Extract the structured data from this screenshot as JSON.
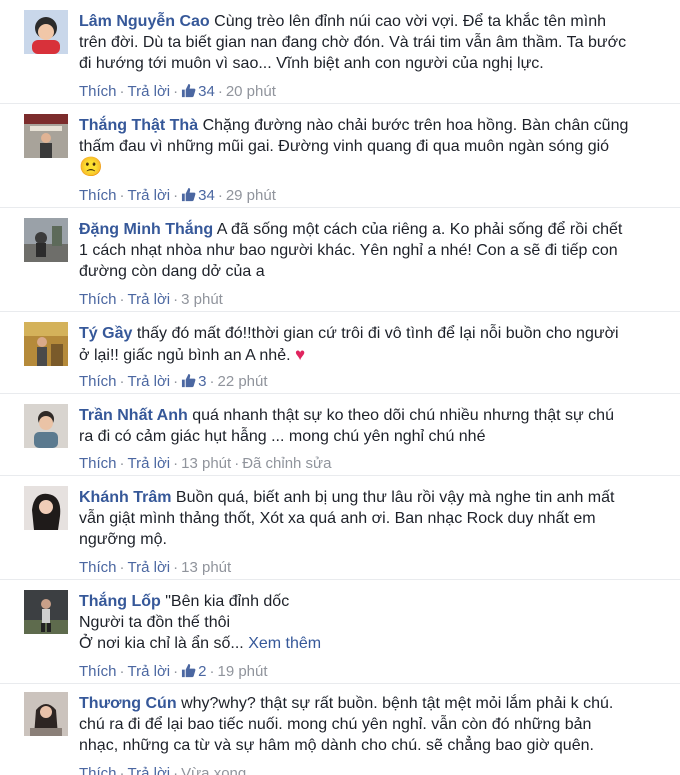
{
  "ui": {
    "like_label": "Thích",
    "reply_label": "Trả lời",
    "dot": "·"
  },
  "comments": [
    {
      "author": "Lâm Nguyễn Cao",
      "lines": [
        "Cùng trèo lên đỉnh núi cao vời vợi. Để ta khắc tên mình",
        "trên đời. Dù ta biết gian nan đang chờ đón. Và trái tim vẫn âm thầm. Ta bước",
        "đi hướng tới muôn vì sao... Vĩnh biệt anh con người của nghị lực."
      ],
      "likes": "34",
      "time": "20 phút"
    },
    {
      "author": "Thắng Thật Thà",
      "lines": [
        "Chặng đường nào chải bước trên hoa hồng. Bàn chân cũng",
        "thấm đau vì những mũi gai. Đường vinh quang đi qua muôn ngàn sóng gió"
      ],
      "emoji": "🙁",
      "likes": "34",
      "time": "29 phút"
    },
    {
      "author": "Đặng Minh Thắng",
      "lines": [
        "A đã sống một cách của riêng a. Ko phải sống để rồi chết",
        "1 cách nhạt nhòa như bao người khác. Yên nghỉ a nhé! Con a sẽ đi tiếp con",
        "đường còn dang dở của a"
      ],
      "time": "3 phút"
    },
    {
      "author": "Tý Gầy",
      "lines": [
        "thấy đó mất đó!!thời gian cứ trôi đi vô tình để lại nỗi buồn cho người",
        "ở lại!! giấc ngủ bình an A nhẻ."
      ],
      "heart": "♥",
      "likes": "3",
      "time": "22 phút"
    },
    {
      "author": "Trần Nhất Anh",
      "lines": [
        "quá nhanh thật sự ko theo dõi chú nhiều nhưng thật sự chú",
        "ra đi có cảm giác hụt hẫng ... mong chú yên nghỉ chú nhé"
      ],
      "time": "13 phút",
      "edited": "Đã chỉnh sửa"
    },
    {
      "author": "Khánh Trâm",
      "lines": [
        "Buồn quá, biết anh bị ung thư lâu rồi vậy mà nghe tin anh mất",
        "vẫn giật mình thảng thốt, Xót xa quá anh ơi. Ban nhạc Rock duy nhất em",
        "ngưỡng mộ."
      ],
      "time": "13 phút"
    },
    {
      "author": "Thắng Lốp",
      "lines": [
        "\"Bên kia đỉnh dốc",
        "Người ta đồn thế thôi",
        "Ở nơi kia chỉ là ẩn số..."
      ],
      "see_more": "Xem thêm",
      "likes": "2",
      "time": "19 phút"
    },
    {
      "author": "Thương Cún",
      "lines": [
        "why?why? thật sự rất buồn. bệnh tật mệt mỏi lắm phải k chú.",
        "chú ra đi để lại bao tiếc nuối. mong chú yên nghỉ. vẫn còn đó những bản",
        "nhạc, những ca từ và sự hâm mộ dành cho chú. sẽ chẳng bao giờ quên."
      ],
      "time": "Vừa xong"
    }
  ],
  "colors": {
    "author": "#365899",
    "meta": "#90949c",
    "action": "#4b67a1",
    "divider": "#e9ebee"
  }
}
